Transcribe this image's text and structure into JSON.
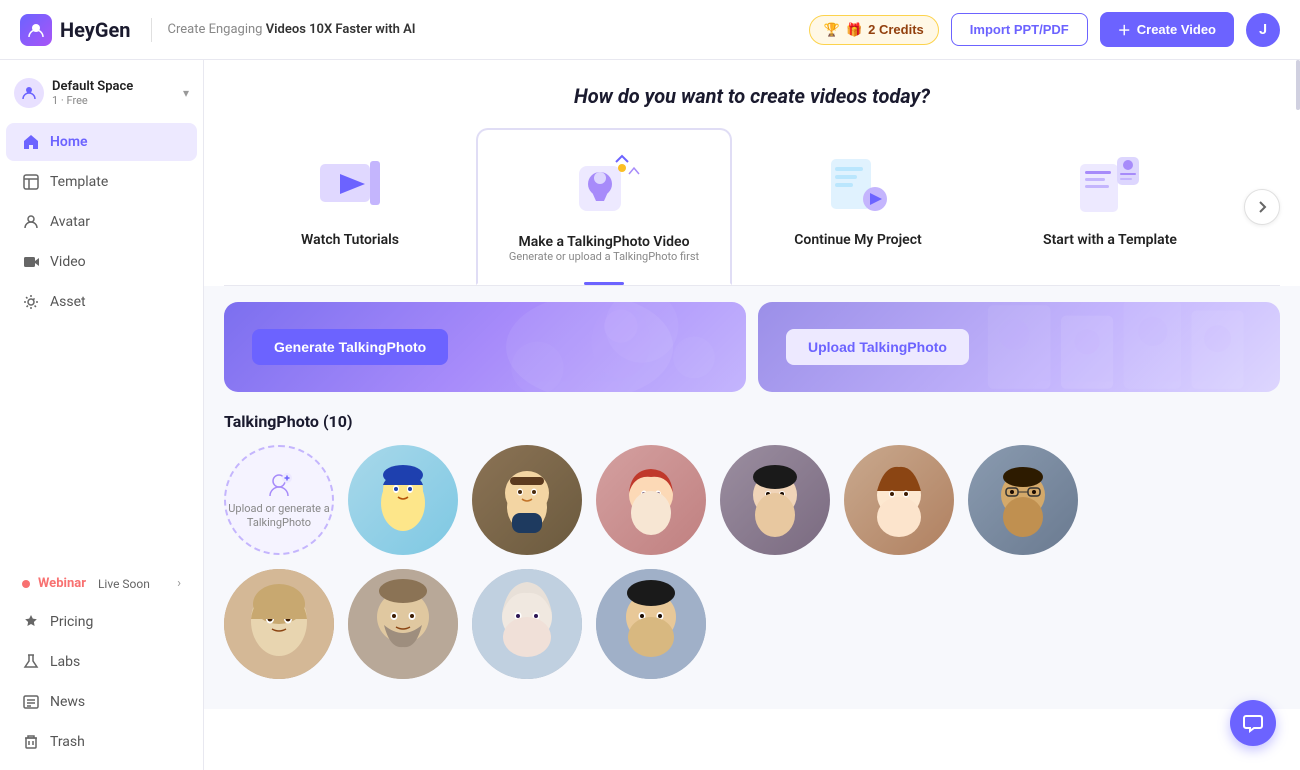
{
  "header": {
    "logo_text": "HeyGen",
    "tagline_pre": "Create Engaging ",
    "tagline_bold": "Videos 10X Faster with AI",
    "credits_label": "2 Credits",
    "import_btn": "Import PPT/PDF",
    "create_btn": "Create Video",
    "avatar_initial": "J"
  },
  "sidebar": {
    "workspace_name": "Default Space",
    "workspace_meta": "1 · Free",
    "items": [
      {
        "id": "home",
        "label": "Home",
        "active": true
      },
      {
        "id": "template",
        "label": "Template",
        "active": false
      },
      {
        "id": "avatar",
        "label": "Avatar",
        "active": false
      },
      {
        "id": "video",
        "label": "Video",
        "active": false
      },
      {
        "id": "asset",
        "label": "Asset",
        "active": false
      }
    ],
    "webinar_label": "Webinar",
    "webinar_sub": "Live Soon",
    "bottom_items": [
      {
        "id": "pricing",
        "label": "Pricing"
      },
      {
        "id": "labs",
        "label": "Labs"
      },
      {
        "id": "news",
        "label": "News"
      },
      {
        "id": "trash",
        "label": "Trash"
      }
    ]
  },
  "main": {
    "create_title": "How do you want to create videos today?",
    "options": [
      {
        "id": "tutorials",
        "label": "Watch Tutorials",
        "sub": ""
      },
      {
        "id": "talkingphoto",
        "label": "Make a TalkingPhoto Video",
        "sub": "Generate or upload a TalkingPhoto first",
        "active": true
      },
      {
        "id": "continue",
        "label": "Continue My Project",
        "sub": ""
      },
      {
        "id": "template",
        "label": "Start with a Template",
        "sub": ""
      }
    ],
    "generate_btn": "Generate TalkingPhoto",
    "upload_btn": "Upload TalkingPhoto",
    "section_title": "TalkingPhoto (10)",
    "upload_placeholder_label": "Upload or generate a TalkingPhoto",
    "avatar_rows": [
      [
        "face-1",
        "face-2",
        "face-3",
        "face-4",
        "face-5",
        "face-6",
        "face-7"
      ],
      [
        "face-8",
        "face-9",
        "face-10",
        "face-11",
        "face-12",
        "face-13",
        "face-14"
      ]
    ]
  }
}
